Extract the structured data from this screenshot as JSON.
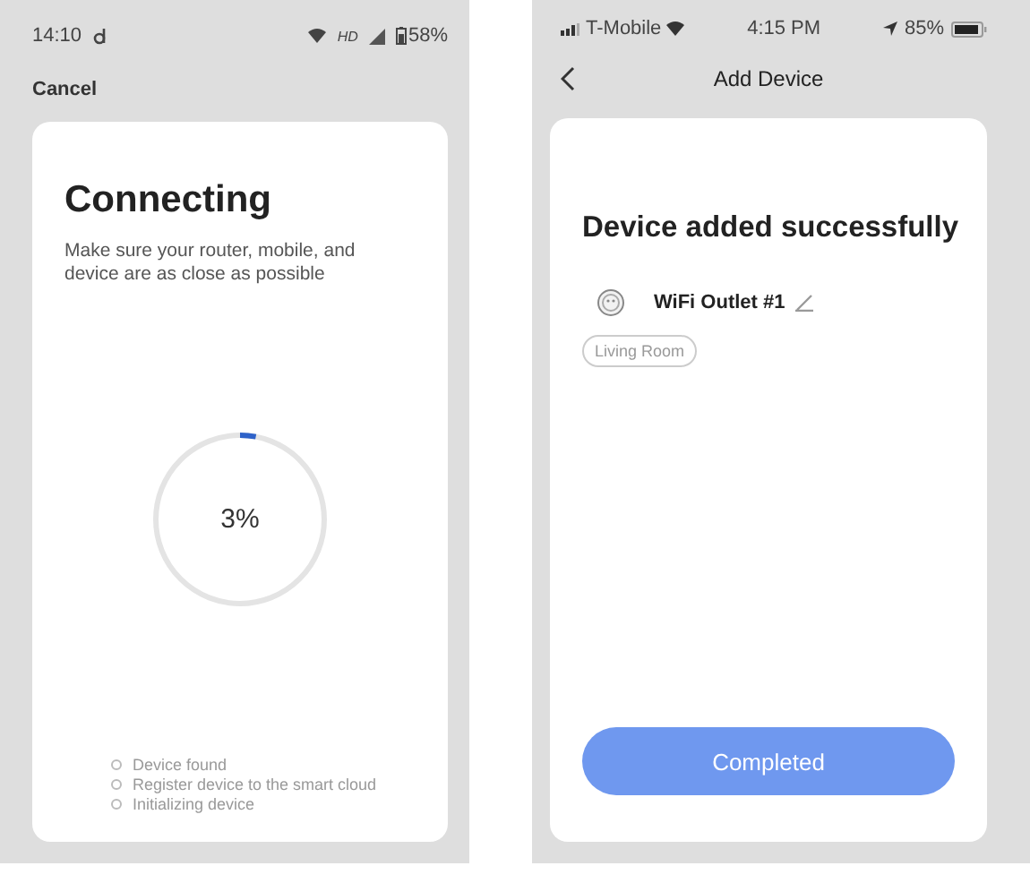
{
  "left_phone": {
    "status_bar": {
      "time": "14:10",
      "network": "HD",
      "battery": "58%"
    },
    "header": {
      "cancel": "Cancel"
    },
    "card": {
      "title": "Connecting",
      "subtitle": "Make sure your router, mobile, and device are as close as possible",
      "progress": {
        "level": 0.03,
        "reading": "3%"
      },
      "steps": [
        "Device found",
        "Register device to the smart cloud",
        "Initializing device"
      ]
    }
  },
  "right_phone": {
    "status_bar": {
      "carrier": "T-Mobile",
      "time": "4:15 PM",
      "battery": "85%"
    },
    "header": {
      "title": "Add Device"
    },
    "card": {
      "title": "Device added successfully",
      "device": {
        "name": "WiFi Outlet #1",
        "room": "Living Room"
      },
      "button": "Completed"
    }
  }
}
